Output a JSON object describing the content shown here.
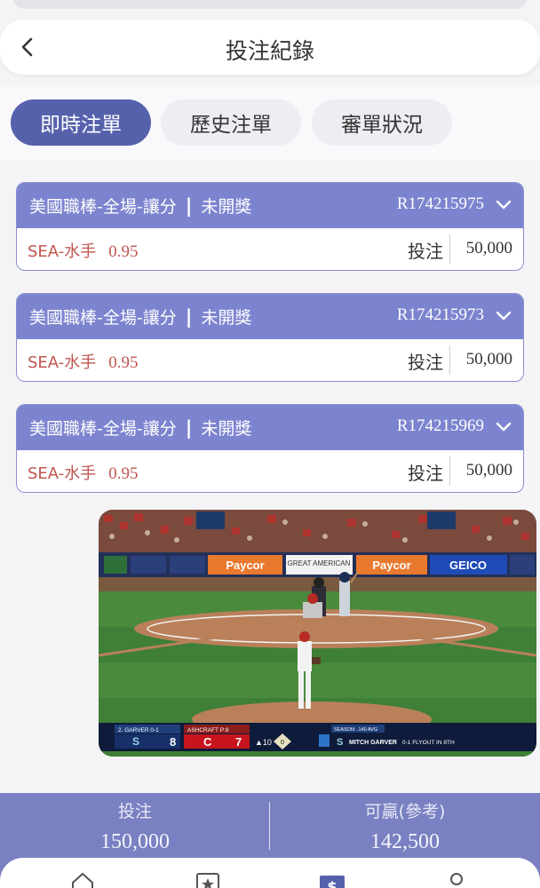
{
  "header": {
    "title": "投注紀錄"
  },
  "tabs": [
    {
      "label": "即時注單",
      "active": true
    },
    {
      "label": "歷史注單",
      "active": false
    },
    {
      "label": "審單狀況",
      "active": false
    }
  ],
  "bets": [
    {
      "type": "美國職棒-全場-讓分",
      "separator": "|",
      "status": "未開獎",
      "order_no": "R174215975",
      "team": "SEA-水手",
      "odds": "0.95",
      "stake_label": "投注",
      "stake": "50,000"
    },
    {
      "type": "美國職棒-全場-讓分",
      "separator": "|",
      "status": "未開獎",
      "order_no": "R174215973",
      "team": "SEA-水手",
      "odds": "0.95",
      "stake_label": "投注",
      "stake": "50,000"
    },
    {
      "type": "美國職棒-全場-讓分",
      "separator": "|",
      "status": "未開獎",
      "order_no": "R174215969",
      "team": "SEA-水手",
      "odds": "0.95",
      "stake_label": "投注",
      "stake": "50,000"
    }
  ],
  "video": {
    "ads": [
      "Paycor",
      "GREAT AMERICAN",
      "Paycor",
      "GEICO"
    ],
    "scorebug": {
      "away_tag": "2. GARVER 0-1",
      "away_logo": "S",
      "away_score": "8",
      "home_tag": "ASHCRAFT P:8",
      "home_logo": "C",
      "home_score": "7",
      "inning": "▲10",
      "outs": "0",
      "season_tag": "SEASON: .140 AVG",
      "batter": "MITCH GARVER",
      "batter_stat": "0-1 FLYOUT IN 8TH"
    }
  },
  "summary": {
    "bet_label": "投注",
    "bet_total": "150,000",
    "win_label": "可贏(參考)",
    "win_total": "142,500"
  },
  "nav": [
    "home-icon",
    "star-card-icon",
    "dollar-ticket-icon",
    "user-icon"
  ],
  "colors": {
    "accent": "#5661ac",
    "card_header": "#7d84cf",
    "pick_text": "#c0564f",
    "summary_bg": "#7a81c2"
  }
}
